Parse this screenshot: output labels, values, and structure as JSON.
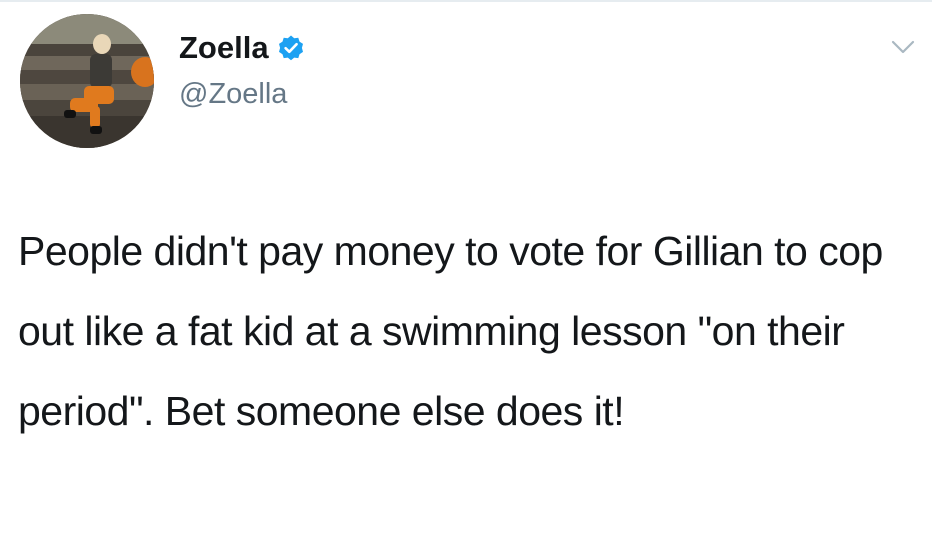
{
  "tweet": {
    "author": {
      "display_name": "Zoella",
      "handle": "@Zoella",
      "verified": true,
      "avatar_icon": "profile-photo",
      "verified_icon": "verified-badge-icon",
      "verified_color": "#1da1f2"
    },
    "menu_icon": "chevron-down-icon",
    "text": "People didn't pay money to vote for Gillian to cop out like a fat kid at a swimming lesson \"on their period\". Bet someone else does it!"
  }
}
